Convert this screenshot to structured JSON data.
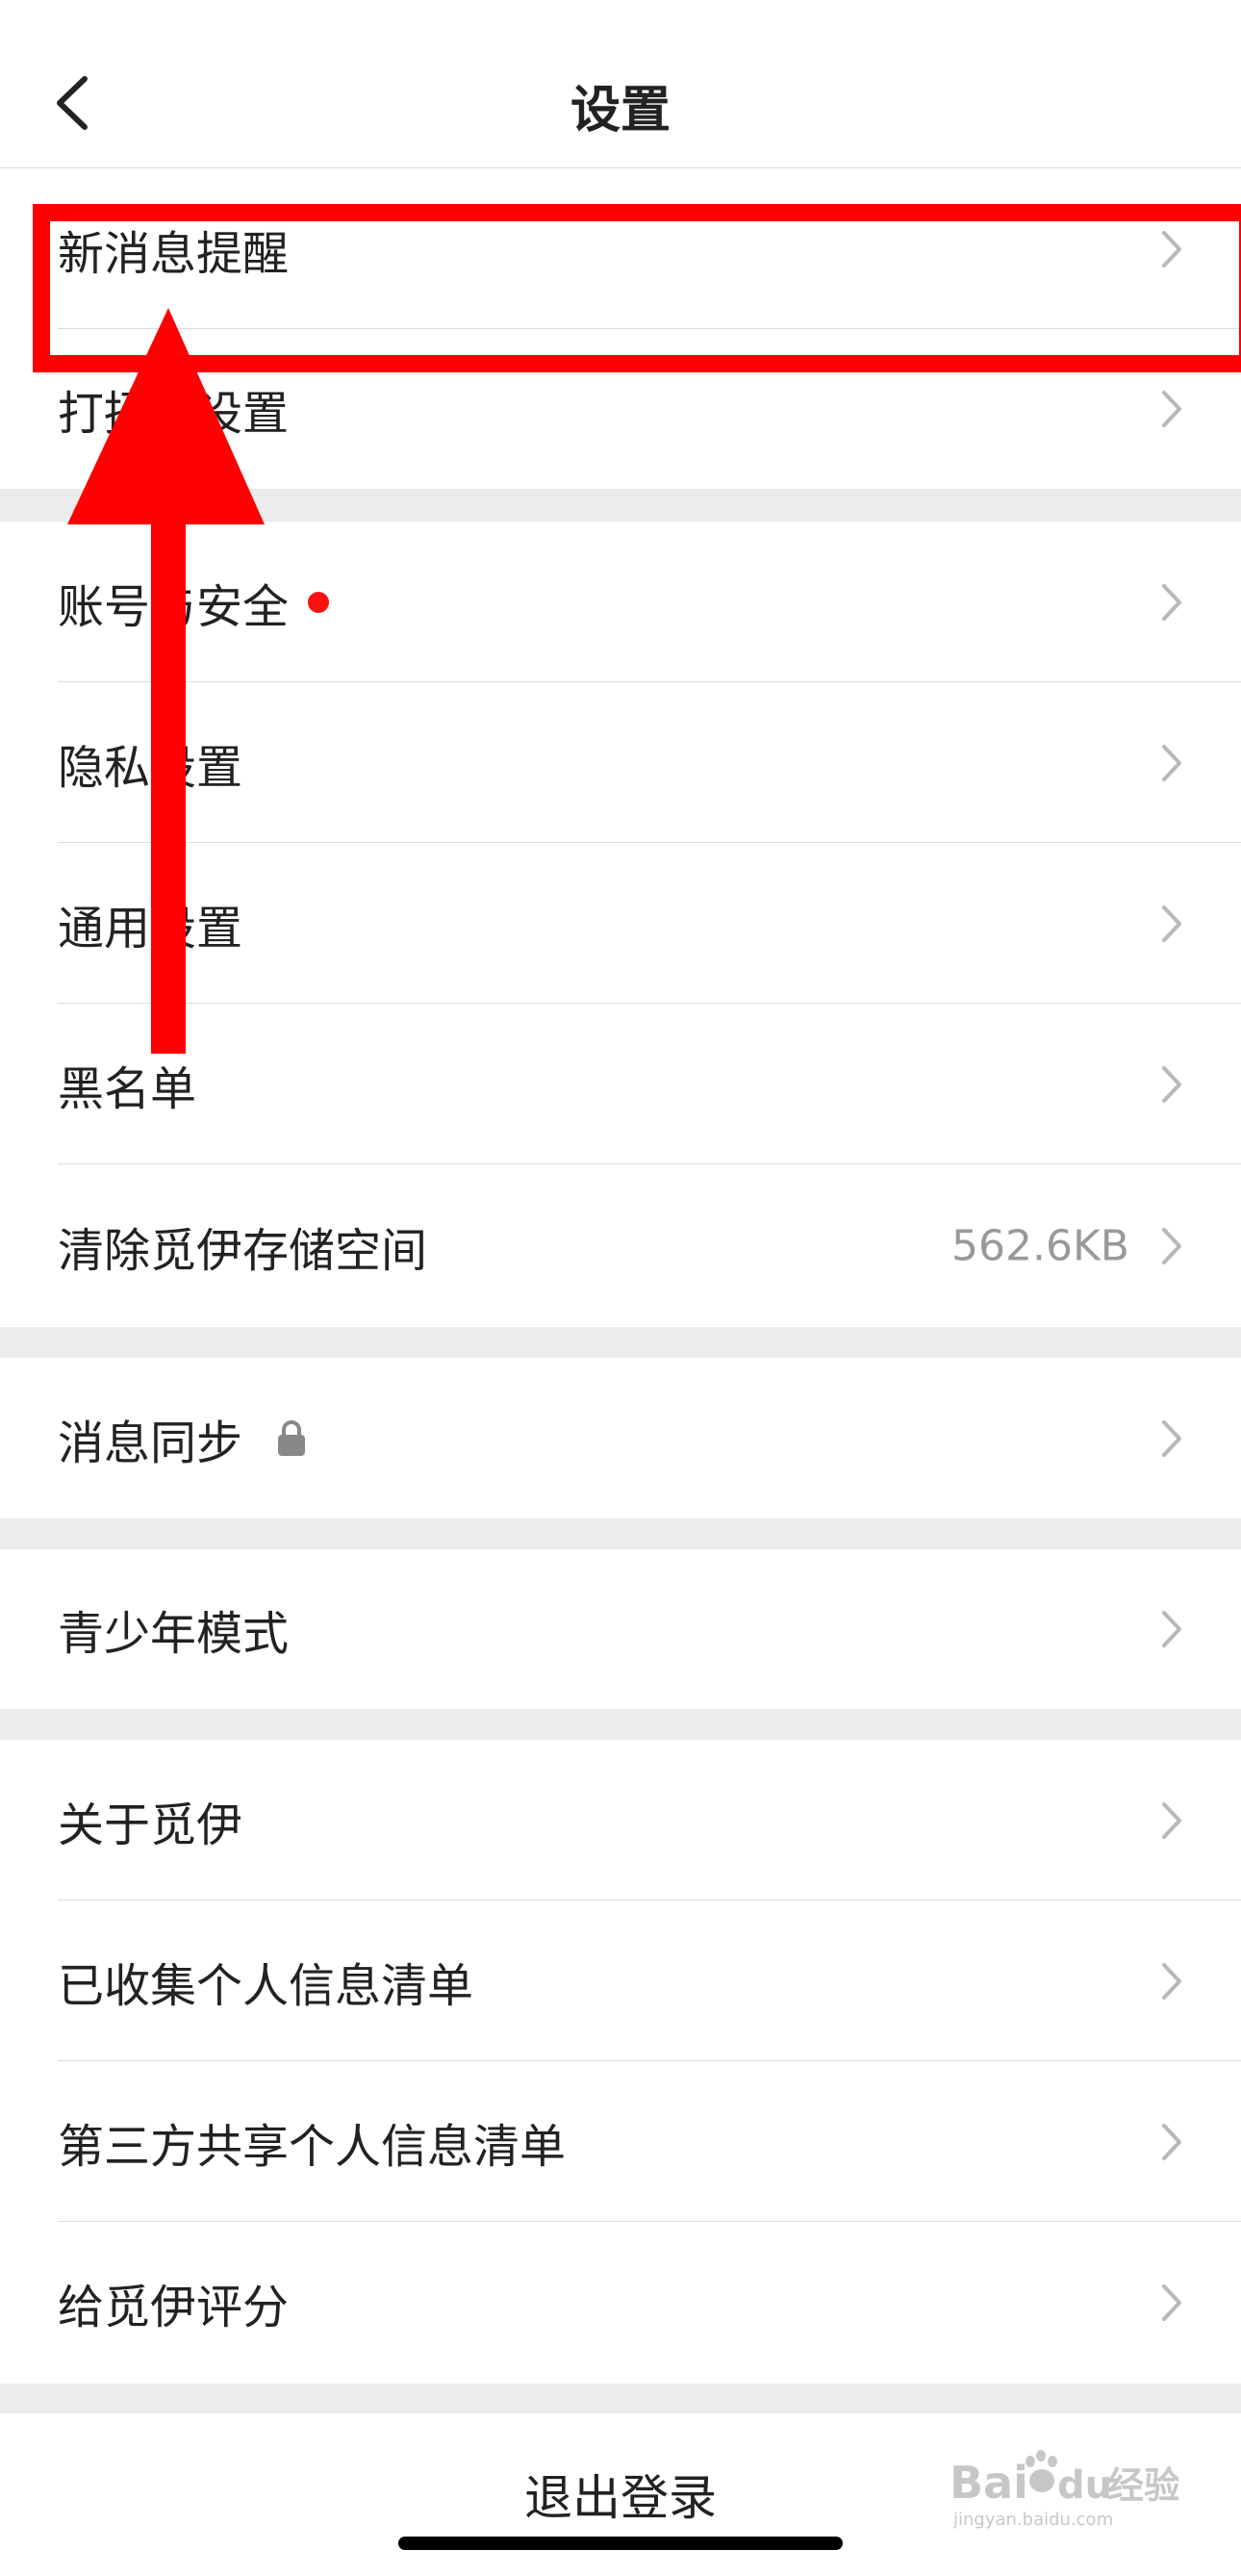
{
  "header": {
    "title": "设置"
  },
  "sections": [
    {
      "rows": [
        {
          "label": "新消息提醒"
        },
        {
          "label": "打招呼设置"
        }
      ]
    },
    {
      "rows": [
        {
          "label": "账号与安全",
          "badge": "red-dot"
        },
        {
          "label": "隐私设置"
        },
        {
          "label": "通用设置"
        },
        {
          "label": "黑名单"
        },
        {
          "label": "清除觅伊存储空间",
          "value": "562.6KB"
        }
      ]
    },
    {
      "rows": [
        {
          "label": "消息同步",
          "icon": "lock-icon"
        }
      ]
    },
    {
      "rows": [
        {
          "label": "青少年模式"
        }
      ]
    },
    {
      "rows": [
        {
          "label": "关于觅伊"
        },
        {
          "label": "已收集个人信息清单"
        },
        {
          "label": "第三方共享个人信息清单"
        },
        {
          "label": "给觅伊评分"
        }
      ]
    }
  ],
  "logout": {
    "label": "退出登录"
  },
  "annotation": {
    "highlight_color": "#ff0000"
  },
  "watermark": {
    "brand": "Bai",
    "brand2": "du",
    "cn": "经验",
    "url": "jingyan.baidu.com"
  },
  "colors": {
    "accent_red": "#ff1010",
    "divider": "#dcdcdc",
    "section_gap": "#ececec"
  }
}
